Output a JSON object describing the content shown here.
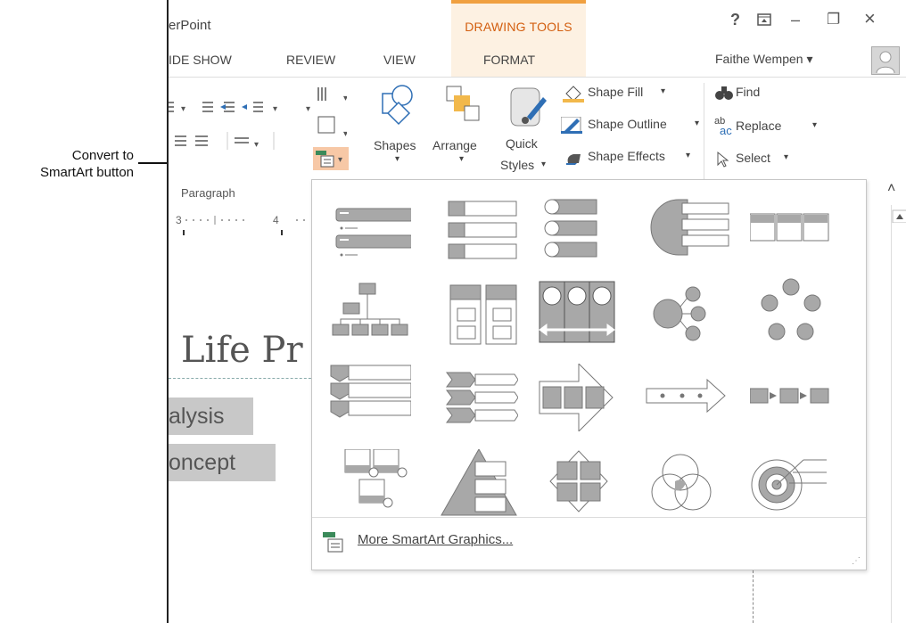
{
  "callout": {
    "line1": "Convert to",
    "line2": "SmartArt button"
  },
  "app": {
    "title": "erPoint"
  },
  "context_group": {
    "label": "DRAWING TOOLS"
  },
  "window_controls": {
    "help": "?",
    "ribbon_display": "▣",
    "minimize": "–",
    "restore": "❐",
    "close": "×"
  },
  "tabs": [
    "IDE SHOW",
    "REVIEW",
    "VIEW",
    "FORMAT"
  ],
  "user": {
    "name": "Faithe Wempen",
    "chevron": "▾"
  },
  "ribbon": {
    "shapes": "Shapes",
    "arrange": "Arrange",
    "quick": "Quick",
    "styles": "Styles",
    "shape_fill": "Shape Fill",
    "shape_outline": "Shape Outline",
    "shape_effects": "Shape Effects",
    "find": "Find",
    "replace": "Replace",
    "select": "Select",
    "group_paragraph": "Paragraph",
    "dropdown": "▾",
    "collapse": "˄"
  },
  "ruler": {
    "left": "3",
    "right": "4"
  },
  "slide": {
    "title_fragment": "Life Pr",
    "line1": "alysis",
    "line2": "oncept"
  },
  "gallery": {
    "more_label": "More SmartArt Graphics..."
  },
  "colors": {
    "accent_orange": "#f0a040",
    "context_fill": "#fdf1e2",
    "context_text": "#d35f10",
    "icon_gray": "#8a8a8a",
    "icon_fill": "#a8a8a8"
  }
}
